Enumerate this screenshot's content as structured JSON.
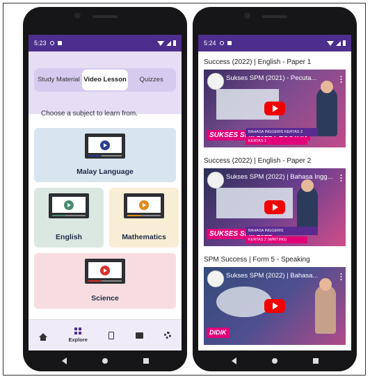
{
  "left_phone": {
    "status": {
      "time": "5:23"
    },
    "tabs": [
      {
        "label": "Study Material",
        "active": false
      },
      {
        "label": "Video Lesson",
        "active": true
      },
      {
        "label": "Quizzes",
        "active": false
      }
    ],
    "prompt": "Choose a subject to learn from.",
    "subjects": [
      {
        "label": "Malay Language",
        "color": "#d9e4f1",
        "accent": "#2c3e8f"
      },
      {
        "label": "English",
        "color": "#dbe8e2",
        "accent": "#4a8a6e"
      },
      {
        "label": "Mathematics",
        "color": "#f7eed5",
        "accent": "#e08a1c"
      },
      {
        "label": "Science",
        "color": "#f7dde1",
        "accent": "#d8302c"
      }
    ],
    "bottom_nav": [
      {
        "icon": "home-icon",
        "label": ""
      },
      {
        "icon": "explore-icon",
        "label": "Explore"
      },
      {
        "icon": "document-icon",
        "label": ""
      },
      {
        "icon": "message-icon",
        "label": ""
      },
      {
        "icon": "settings-icon",
        "label": ""
      }
    ]
  },
  "right_phone": {
    "status": {
      "time": "5:24"
    },
    "videos": [
      {
        "title": "Success (2022) | English - Paper 1",
        "thumb_text": "Sukses SPM (2021) - Pecuta...",
        "banner": "SUKSES SPM 2021 PECUTAN",
        "strip": "BAHASA INGGERIS KERTAS 2",
        "strip2": "KERTAS 1"
      },
      {
        "title": "Success (2022) | English - Paper 2",
        "thumb_text": "Sukses SPM (2022) | Bahasa Ingg...",
        "banner": "SUKSES SPM 2022",
        "strip": "BAHASA INGGERIS",
        "strip2": "KERTAS 2 (WRITING)"
      },
      {
        "title": "SPM Success | Form 5 - Speaking",
        "thumb_text": "Sukses SPM (2022) | Bahasa...",
        "banner": "DIDIK",
        "strip": "",
        "strip2": ""
      }
    ]
  },
  "colors": {
    "status_bar": "#4c2f8c",
    "youtube_red": "#f20000",
    "header_bg": "#e6def5"
  }
}
